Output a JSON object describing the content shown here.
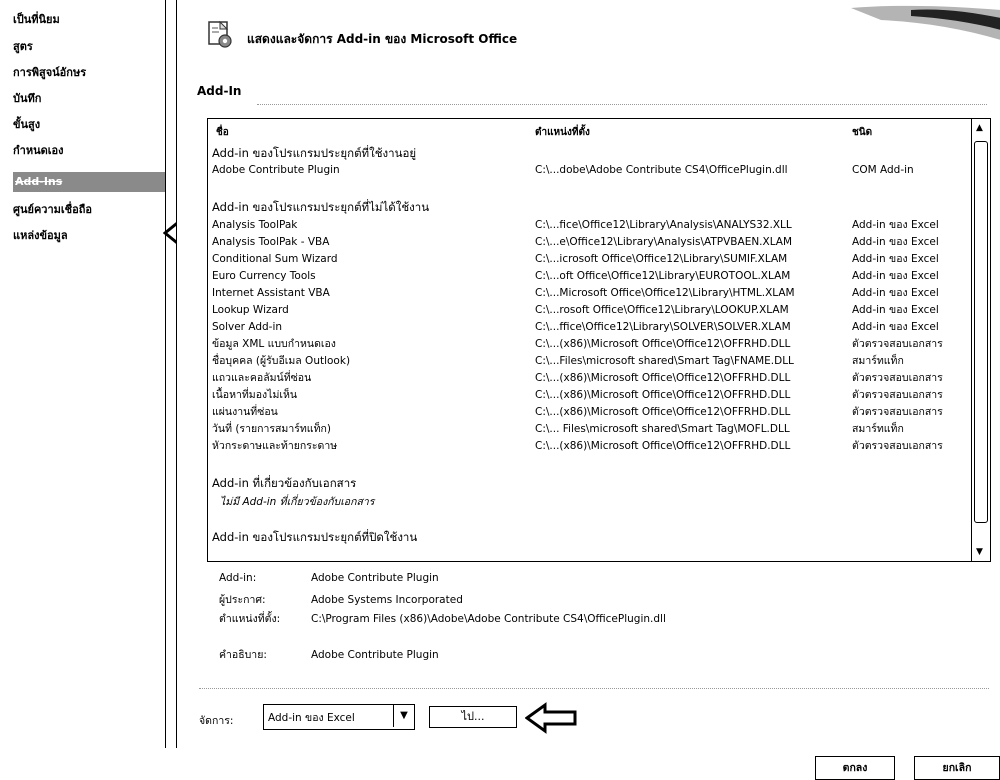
{
  "sidebar": {
    "items": [
      {
        "label": "เป็นที่นิยม"
      },
      {
        "label": "สูตร"
      },
      {
        "label": "การพิสูจน์อักษร"
      },
      {
        "label": "บันทึก"
      },
      {
        "label": "ขั้นสูง"
      },
      {
        "label": "กำหนดเอง"
      },
      {
        "label": "Add-Ins"
      },
      {
        "label": "ศูนย์ความเชื่อถือ"
      },
      {
        "label": "แหล่งข้อมูล"
      }
    ]
  },
  "header": {
    "title": "แสดงและจัดการ  Add-in ของ Microsoft Office"
  },
  "section": {
    "title": "Add-In"
  },
  "list": {
    "columns": {
      "name": "ชื่อ",
      "location": "ตำแหน่งที่ตั้ง",
      "type": "ชนิด"
    },
    "active_group": "Add-in ของโปรแกรมประยุกต์ที่ใช้งานอยู่",
    "active_rows": [
      {
        "name": "Adobe Contribute Plugin",
        "location": "C:\\...dobe\\Adobe Contribute CS4\\OfficePlugin.dll",
        "type": "COM Add-in"
      }
    ],
    "inactive_group": "Add-in ของโปรแกรมประยุกต์ที่ไม่ได้ใช้งาน",
    "inactive_rows": [
      {
        "name": "Analysis ToolPak",
        "location": "C:\\...fice\\Office12\\Library\\Analysis\\ANALYS32.XLL",
        "type": "Add-in ของ Excel"
      },
      {
        "name": "Analysis ToolPak - VBA",
        "location": "C:\\...e\\Office12\\Library\\Analysis\\ATPVBAEN.XLAM",
        "type": "Add-in ของ Excel"
      },
      {
        "name": "Conditional Sum Wizard",
        "location": "C:\\...icrosoft Office\\Office12\\Library\\SUMIF.XLAM",
        "type": "Add-in ของ Excel"
      },
      {
        "name": "Euro Currency Tools",
        "location": "C:\\...oft Office\\Office12\\Library\\EUROTOOL.XLAM",
        "type": "Add-in ของ Excel"
      },
      {
        "name": "Internet Assistant VBA",
        "location": "C:\\...Microsoft Office\\Office12\\Library\\HTML.XLAM",
        "type": "Add-in ของ Excel"
      },
      {
        "name": "Lookup Wizard",
        "location": "C:\\...rosoft Office\\Office12\\Library\\LOOKUP.XLAM",
        "type": "Add-in ของ Excel"
      },
      {
        "name": "Solver Add-in",
        "location": "C:\\...ffice\\Office12\\Library\\SOLVER\\SOLVER.XLAM",
        "type": "Add-in ของ Excel"
      },
      {
        "name": "ข้อมูล XML แบบกำหนดเอง",
        "location": "C:\\...(x86)\\Microsoft Office\\Office12\\OFFRHD.DLL",
        "type": "ตัวตรวจสอบเอกสาร"
      },
      {
        "name": "ชื่อบุคคล (ผู้รับอีเมล Outlook)",
        "location": "C:\\...Files\\microsoft shared\\Smart Tag\\FNAME.DLL",
        "type": "สมาร์ทแท็ก"
      },
      {
        "name": "แถวและคอลัมน์ที่ซ่อน",
        "location": "C:\\...(x86)\\Microsoft Office\\Office12\\OFFRHD.DLL",
        "type": "ตัวตรวจสอบเอกสาร"
      },
      {
        "name": "เนื้อหาที่มองไม่เห็น",
        "location": "C:\\...(x86)\\Microsoft Office\\Office12\\OFFRHD.DLL",
        "type": "ตัวตรวจสอบเอกสาร"
      },
      {
        "name": "แผ่นงานที่ซ่อน",
        "location": "C:\\...(x86)\\Microsoft Office\\Office12\\OFFRHD.DLL",
        "type": "ตัวตรวจสอบเอกสาร"
      },
      {
        "name": "วันที่ (รายการสมาร์ทแท็ก)",
        "location": "C:\\... Files\\microsoft shared\\Smart Tag\\MOFL.DLL",
        "type": "สมาร์ทแท็ก"
      },
      {
        "name": "หัวกระดาษและท้ายกระดาษ",
        "location": "C:\\...(x86)\\Microsoft Office\\Office12\\OFFRHD.DLL",
        "type": "ตัวตรวจสอบเอกสาร"
      }
    ],
    "doc_group": "Add-in ที่เกี่ยวข้องกับเอกสาร",
    "doc_note": "ไม่มี Add-in ที่เกี่ยวข้องกับเอกสาร",
    "disabled_group": "Add-in ของโปรแกรมประยุกต์ที่ปิดใช้งาน"
  },
  "details": {
    "addin_label": "Add-in:",
    "addin_value": "Adobe Contribute Plugin",
    "publisher_label": "ผู้ประกาศ:",
    "publisher_value": "Adobe Systems Incorporated",
    "location_label": "ตำแหน่งที่ตั้ง:",
    "location_value": "C:\\Program Files (x86)\\Adobe\\Adobe Contribute CS4\\OfficePlugin.dll",
    "desc_label": "คำอธิบาย:",
    "desc_value": "Adobe Contribute Plugin"
  },
  "manage": {
    "label": "จัดการ:",
    "selected": "Add-in ของ Excel",
    "go_label": "ไป..."
  },
  "footer": {
    "ok_label": "ตกลง",
    "cancel_label": "ยกเลิก"
  },
  "colors": {
    "selected_bg": "#8a8a8a",
    "border": "#000000"
  }
}
